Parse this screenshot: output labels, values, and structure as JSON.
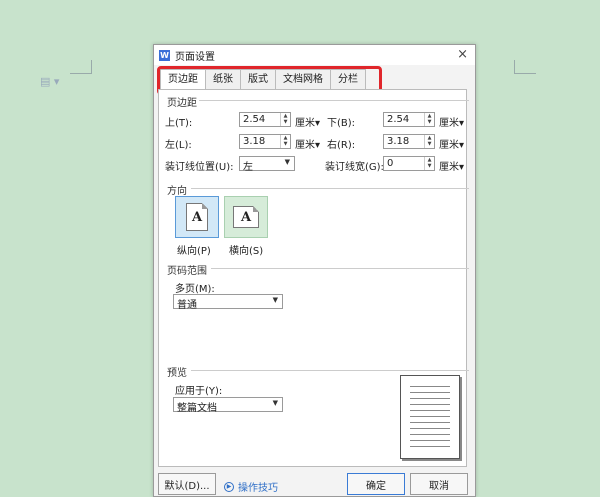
{
  "background": {
    "doc_icon": "document-icon"
  },
  "dialog": {
    "title": "页面设置",
    "app_icon": "W",
    "close": "×",
    "tabs": [
      {
        "label": "页边距",
        "active": true
      },
      {
        "label": "纸张",
        "active": false
      },
      {
        "label": "版式",
        "active": false
      },
      {
        "label": "文档网格",
        "active": false
      },
      {
        "label": "分栏",
        "active": false
      }
    ],
    "highlight_color": "#e0262b"
  },
  "margins": {
    "section_label": "页边距",
    "top": {
      "label": "上(T):",
      "value": "2.54",
      "unit": "厘米▾"
    },
    "bottom": {
      "label": "下(B):",
      "value": "2.54",
      "unit": "厘米▾"
    },
    "left": {
      "label": "左(L):",
      "value": "3.18",
      "unit": "厘米▾"
    },
    "right": {
      "label": "右(R):",
      "value": "3.18",
      "unit": "厘米▾"
    },
    "gutter_pos": {
      "label": "装订线位置(U):",
      "value": "左"
    },
    "gutter": {
      "label": "装订线宽(G):",
      "value": "0",
      "unit": "厘米▾"
    }
  },
  "orientation": {
    "section_label": "方向",
    "portrait": {
      "label": "纵向(P)",
      "glyph": "A",
      "selected": true
    },
    "landscape": {
      "label": "横向(S)",
      "glyph": "A",
      "selected": false
    }
  },
  "page_range": {
    "section_label": "页码范围",
    "multiple_label": "多页(M):",
    "multiple_value": "普通"
  },
  "preview": {
    "section_label": "预览",
    "apply_label": "应用于(Y):",
    "apply_value": "整篇文档"
  },
  "footer": {
    "default_button": "默认(D)...",
    "tips_link": "操作技巧",
    "ok_button": "确定",
    "cancel_button": "取消"
  }
}
